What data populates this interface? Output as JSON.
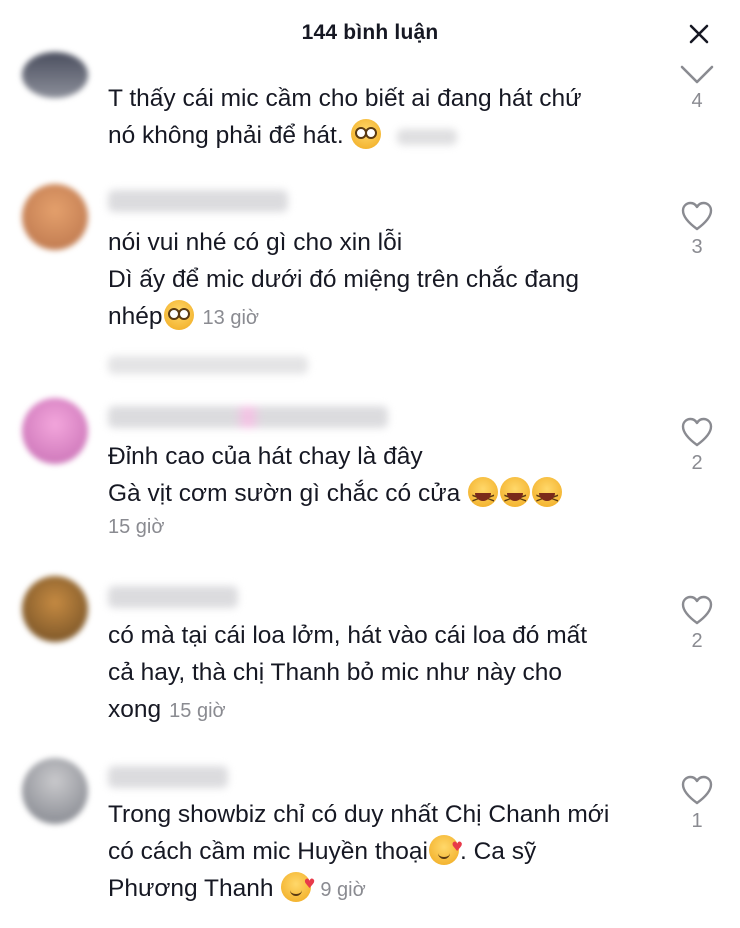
{
  "header": {
    "title": "144 bình luận",
    "close_icon": "close-icon"
  },
  "comments": [
    {
      "lines": [
        "T thấy cái mic cầm cho biết ai đang hát chứ",
        "nó không phải để hát."
      ],
      "emoji": "flushed-emoji",
      "time": "",
      "likes": "4"
    },
    {
      "lines": [
        "nói vui nhé có gì cho xin lỗi",
        "Dì ấy để mic dưới đó miệng trên chắc đang",
        "nhép"
      ],
      "emoji": "flushed-emoji",
      "time": "13 giờ",
      "likes": "3"
    },
    {
      "lines": [
        "Đỉnh cao của hát chay là đây",
        "Gà vịt cơm sườn gì chắc có cửa"
      ],
      "emoji": "laughing-emoji",
      "time": "15 giờ",
      "likes": "2"
    },
    {
      "lines": [
        "có mà tại cái loa lởm, hát vào cái loa đó mất",
        "cả hay, thà chị Thanh bỏ mic như này cho",
        "xong"
      ],
      "time": "15 giờ",
      "likes": "2"
    },
    {
      "lines": [
        "Trong showbiz chỉ có duy nhất Chị Chanh mới",
        "có cách cầm mic Huyền thoại",
        ". Ca sỹ",
        "Phương Thanh"
      ],
      "emoji": "smiling-hearts-emoji",
      "time": "9 giờ",
      "likes": "1"
    }
  ]
}
